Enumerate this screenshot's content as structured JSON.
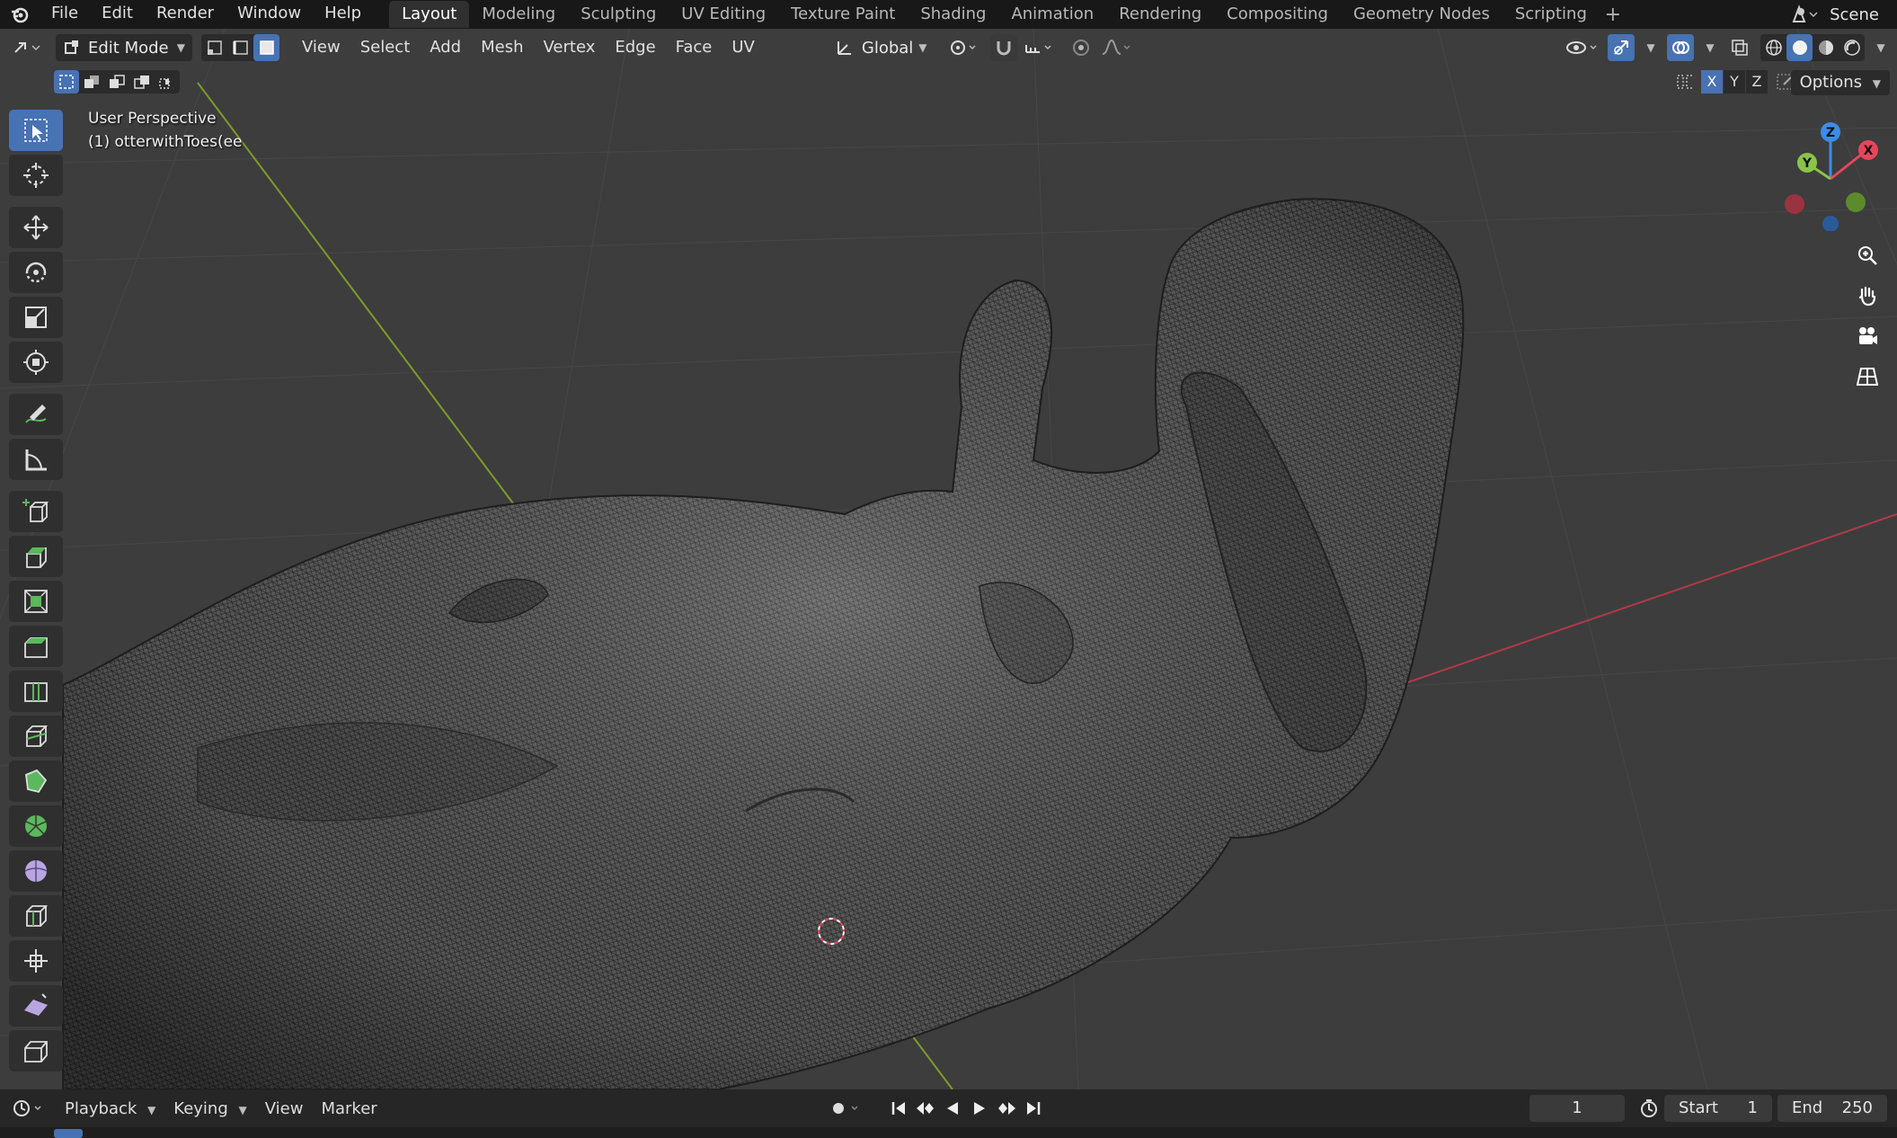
{
  "topbar": {
    "menus": [
      "File",
      "Edit",
      "Render",
      "Window",
      "Help"
    ],
    "workspaces": [
      "Layout",
      "Modeling",
      "Sculpting",
      "UV Editing",
      "Texture Paint",
      "Shading",
      "Animation",
      "Rendering",
      "Compositing",
      "Geometry Nodes",
      "Scripting"
    ],
    "active_workspace": "Layout",
    "scene": "Scene"
  },
  "viewport_header": {
    "mode": "Edit Mode",
    "menus": [
      "View",
      "Select",
      "Add",
      "Mesh",
      "Vertex",
      "Edge",
      "Face",
      "UV"
    ],
    "transform_orientation": "Global",
    "options_label": "Options",
    "mirror_axes": [
      "X",
      "Y",
      "Z"
    ]
  },
  "viewport_info": {
    "perspective": "User Perspective",
    "object": "(1) otterwithToes(ee"
  },
  "gizmo": {
    "x": "X",
    "y": "Y",
    "z": "Z"
  },
  "toolbar": {
    "tools": [
      "select-box",
      "cursor",
      "move",
      "rotate",
      "scale",
      "transform",
      "annotate",
      "measure",
      "add-cube",
      "extrude-region",
      "inset-faces",
      "bevel",
      "loop-cut",
      "knife",
      "poly-build",
      "spin",
      "smooth",
      "edge-slide",
      "shrink-fatten",
      "shear",
      "rip-region"
    ],
    "active_tool": "select-box"
  },
  "timeline": {
    "menus": [
      "Playback",
      "Keying",
      "View",
      "Marker"
    ],
    "current_frame": "1",
    "start_label": "Start",
    "start_value": "1",
    "end_label": "End",
    "end_value": "250"
  },
  "colors": {
    "accent": "#4772b3",
    "viewport_bg": "#3d3d3d",
    "x_axis": "#e8455a",
    "y_axis": "#8bc34a",
    "z_axis": "#3b8de8"
  }
}
